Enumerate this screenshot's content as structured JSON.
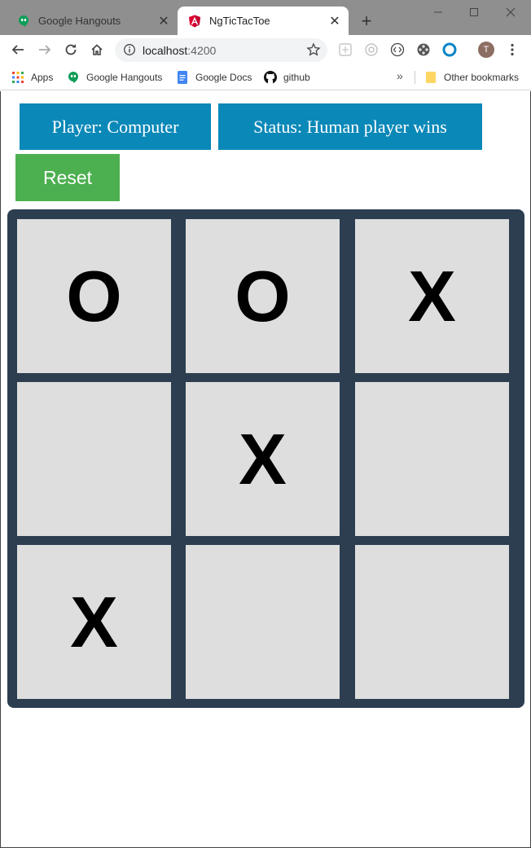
{
  "browser": {
    "tabs": [
      {
        "title": "Google Hangouts",
        "active": false
      },
      {
        "title": "NgTicTacToe",
        "active": true
      }
    ],
    "url_host": "localhost",
    "url_port": ":4200",
    "profile_initial": "T",
    "bookmarks": [
      {
        "label": "Apps",
        "icon": "apps-grid-icon"
      },
      {
        "label": "Google Hangouts",
        "icon": "hangouts-icon"
      },
      {
        "label": "Google Docs",
        "icon": "docs-icon"
      },
      {
        "label": "github",
        "icon": "github-icon"
      }
    ],
    "other_bookmarks": "Other bookmarks",
    "overflow": "»"
  },
  "game": {
    "player_text": "Player: Computer",
    "status_text": "Status: Human player wins",
    "reset_label": "Reset",
    "board": [
      "O",
      "O",
      "X",
      "",
      "X",
      "",
      "X",
      "",
      ""
    ]
  },
  "colors": {
    "info_bg": "#0a88b8",
    "reset_bg": "#4caf50",
    "board_bg": "#2c3e50",
    "cell_bg": "#dedede"
  }
}
